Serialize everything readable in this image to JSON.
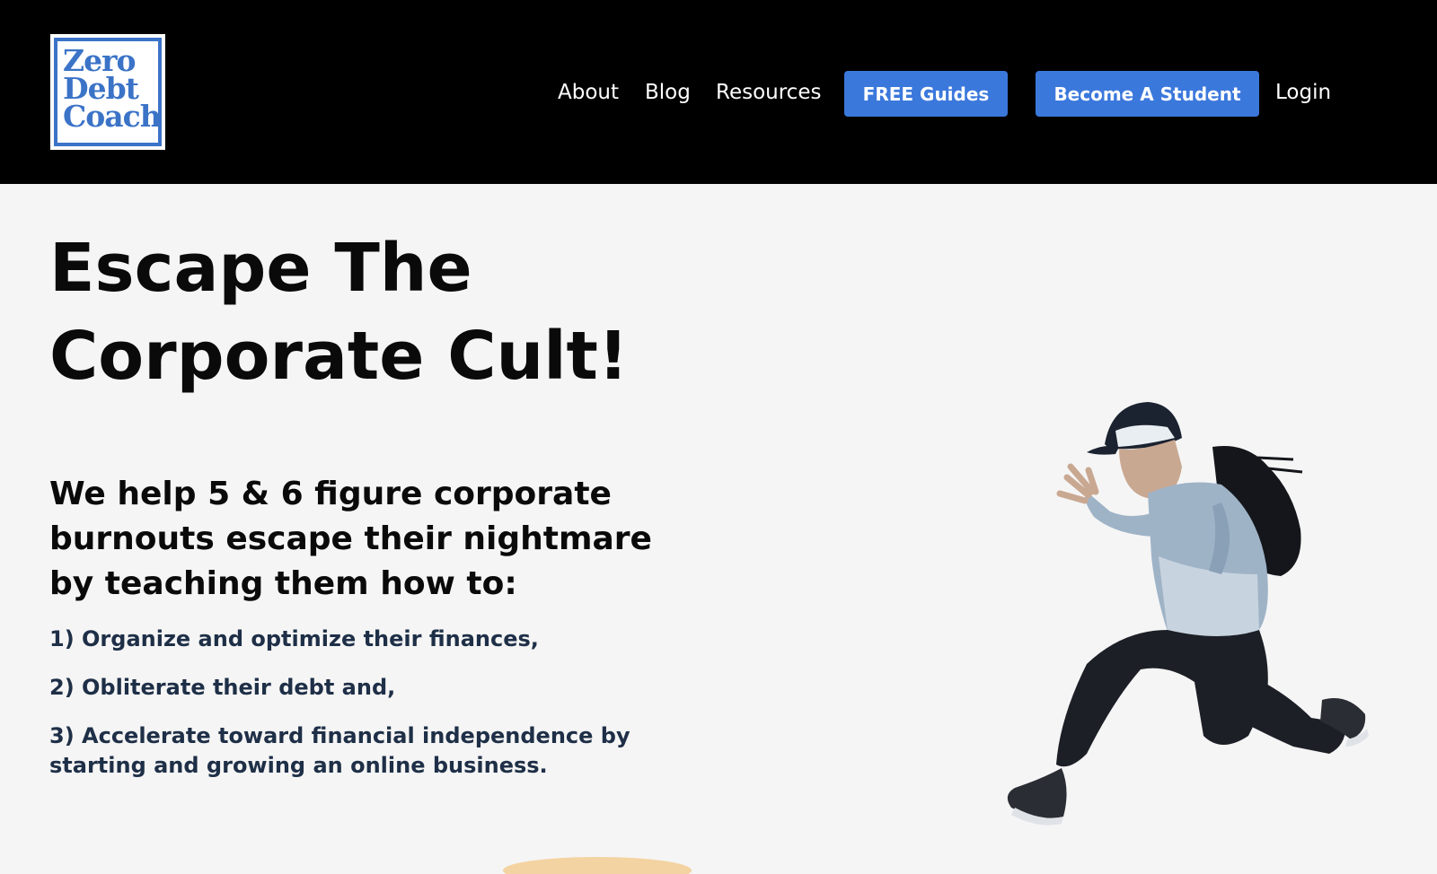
{
  "logo": {
    "lines": [
      "Zero",
      "Debt",
      "Coach"
    ]
  },
  "nav": {
    "about": "About",
    "blog": "Blog",
    "resources": "Resources",
    "free_guides": "FREE Guides",
    "become_student": "Become A Student",
    "login": "Login"
  },
  "hero": {
    "title_line1": "Escape The",
    "title_line2": "Corporate Cult!",
    "subheading": "We help 5 & 6 figure corporate burnouts escape their nightmare by teaching them how to:",
    "points": [
      "1) Organize and optimize their finances,",
      "2) Obliterate their debt and,",
      "3) Accelerate toward financial independence by starting and growing an online business."
    ]
  },
  "colors": {
    "accent": "#3b78dc",
    "header_bg": "#000000",
    "page_bg": "#f5f5f5",
    "logo": "#3b73c7"
  },
  "icons": {
    "hero_image": "jumping-man-image"
  }
}
